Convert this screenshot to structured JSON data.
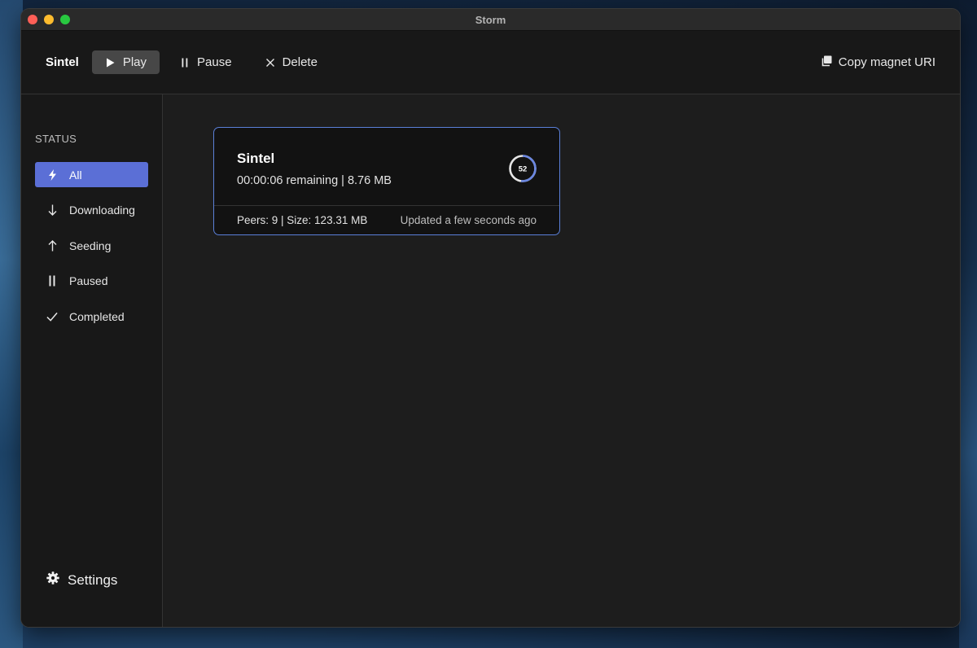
{
  "window": {
    "title": "Storm"
  },
  "toolbar": {
    "selected_name": "Sintel",
    "play_label": "Play",
    "pause_label": "Pause",
    "delete_label": "Delete",
    "copy_magnet_label": "Copy magnet URI"
  },
  "sidebar": {
    "heading": "STATUS",
    "items": [
      {
        "label": "All",
        "icon": "bolt-icon",
        "active": true
      },
      {
        "label": "Downloading",
        "icon": "arrow-down-icon",
        "active": false
      },
      {
        "label": "Seeding",
        "icon": "arrow-up-icon",
        "active": false
      },
      {
        "label": "Paused",
        "icon": "pause-icon",
        "active": false
      },
      {
        "label": "Completed",
        "icon": "checkmark-icon",
        "active": false
      }
    ],
    "settings_label": "Settings"
  },
  "torrents": [
    {
      "name": "Sintel",
      "status_line": "00:00:06 remaining | 8.76 MB",
      "progress_label": "52",
      "progress": 0.52,
      "meta_line": "Peers: 9 | Size: 123.31 MB",
      "updated": "Updated a few seconds ago"
    }
  ],
  "colors": {
    "accent": "#5b6fd6",
    "card_border": "#5a7fd8",
    "progress_ring": "#6a86e0"
  }
}
